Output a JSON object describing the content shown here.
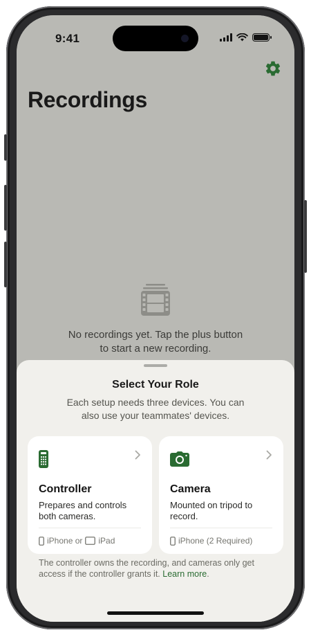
{
  "status_bar": {
    "time": "9:41"
  },
  "header": {
    "title": "Recordings",
    "settings_icon": "gear-icon"
  },
  "empty_state": {
    "icon": "film-stack-icon",
    "message": "No recordings yet. Tap the plus button to start a new recording."
  },
  "sheet": {
    "title": "Select Your Role",
    "subtitle": "Each setup needs three devices. You can also use your teammates' devices.",
    "cards": [
      {
        "icon": "remote-control-icon",
        "title": "Controller",
        "description": "Prepares and controls both cameras.",
        "device_1": "iPhone or",
        "device_2": "iPad"
      },
      {
        "icon": "camera-icon",
        "title": "Camera",
        "description": "Mounted on tripod to record.",
        "device_1": "iPhone (2 Required)"
      }
    ],
    "footnote": "The controller owns the recording, and cameras only get access if the controller grants it.",
    "learn_more": "Learn more",
    "footnote_end": "."
  },
  "colors": {
    "accent": "#2a6b32",
    "background_dimmed": "#b9b9b4",
    "sheet": "#f1f0ec",
    "card": "#ffffff"
  }
}
